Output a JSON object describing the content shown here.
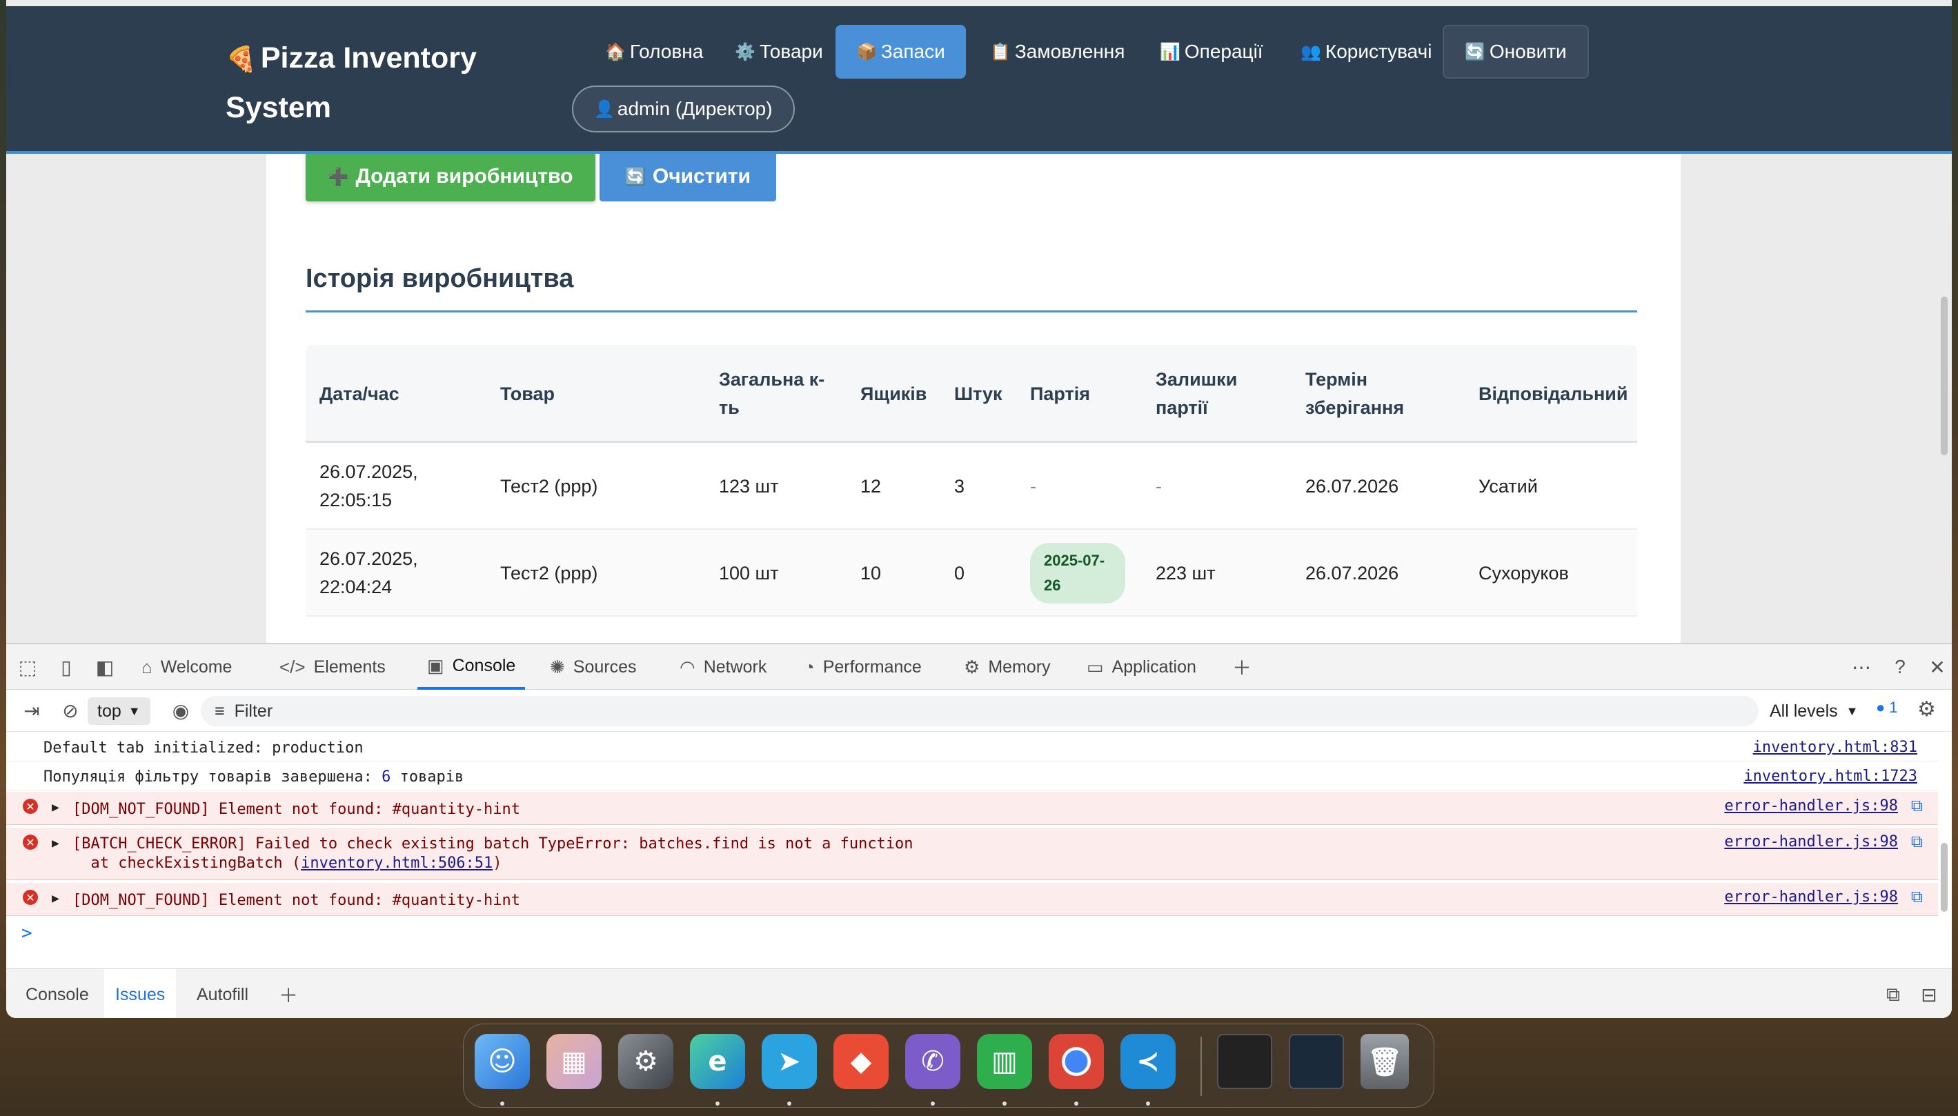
{
  "app": {
    "brand_icon": "🍕",
    "brand_title": "Pizza Inventory System",
    "nav": [
      {
        "icon": "🏠",
        "label": "Головна"
      },
      {
        "icon": "⚙️",
        "label": "Товари"
      },
      {
        "icon": "📦",
        "label": "Запаси",
        "active": true
      },
      {
        "icon": "📋",
        "label": "Замовлення"
      },
      {
        "icon": "📊",
        "label": "Операції"
      },
      {
        "icon": "👥",
        "label": "Користувачі"
      }
    ],
    "refresh": {
      "icon": "🔄",
      "label": "Оновити"
    },
    "user": {
      "icon": "👤",
      "label": "admin (Директор)"
    }
  },
  "actions": {
    "add_icon": "➕",
    "add_label": "Додати виробництво",
    "clear_icon": "🔄",
    "clear_label": "Очистити"
  },
  "history": {
    "title": "Історія виробництва",
    "columns": [
      "Дата/час",
      "Товар",
      "Загальна к-ть",
      "Ящиків",
      "Штук",
      "Партія",
      "Залишки партії",
      "Термін зберігання",
      "Відповідальний"
    ],
    "rows": [
      {
        "datetime": "26.07.2025, 22:05:15",
        "product": "Тест2 (ррр)",
        "total": "123 шт",
        "boxes": "12",
        "pieces": "3",
        "batch": "-",
        "batch_left": "-",
        "expiry": "26.07.2026",
        "responsible": "Усатий"
      },
      {
        "datetime": "26.07.2025, 22:04:24",
        "product": "Тест2 (ррр)",
        "total": "100 шт",
        "boxes": "10",
        "pieces": "0",
        "batch": "2025-07-26",
        "batch_left": "223 шт",
        "expiry": "26.07.2026",
        "responsible": "Сухоруков"
      }
    ]
  },
  "devtools": {
    "tabs": [
      "Welcome",
      "Elements",
      "Console",
      "Sources",
      "Network",
      "Performance",
      "Memory",
      "Application"
    ],
    "active_tab": "Console",
    "context": "top",
    "filter_placeholder": "Filter",
    "levels": "All levels",
    "issues_count": "1",
    "logs": [
      {
        "type": "info",
        "text": "Default tab initialized: production",
        "source": "inventory.html:831"
      },
      {
        "type": "info",
        "text_before": "Популяція фільтру товарів завершена: ",
        "number": "6",
        "text_after": " товарів",
        "source": "inventory.html:1723"
      },
      {
        "type": "error",
        "text": "[DOM_NOT_FOUND] Element not found: #quantity-hint",
        "source": "error-handler.js:98"
      },
      {
        "type": "error",
        "text": "[BATCH_CHECK_ERROR] Failed to check existing batch TypeError: batches.find is not a function",
        "stack_prefix": "  at checkExistingBatch (",
        "stack_link": "inventory.html:506:51",
        "stack_suffix": ")",
        "source": "error-handler.js:98"
      },
      {
        "type": "error",
        "text": "[DOM_NOT_FOUND] Element not found: #quantity-hint",
        "source": "error-handler.js:98"
      }
    ],
    "prompt": ">",
    "drawer_tabs": [
      "Console",
      "Issues",
      "Autofill"
    ],
    "drawer_active": "Issues"
  },
  "dock": {
    "apps": [
      "finder-icon",
      "launchpad-icon",
      "system-settings-icon",
      "edge-icon",
      "telegram-icon",
      "anydesk-icon",
      "viber-icon",
      "numbers-icon",
      "chrome-icon",
      "vscode-icon"
    ],
    "colors": {
      "finder": "#3a8ee6",
      "edge": "#1e9be0",
      "telegram": "#2aa3e0",
      "anydesk": "#e94b35",
      "viber": "#7b5cc8",
      "numbers": "#2fae4e",
      "vscode": "#1f8ad6"
    }
  }
}
